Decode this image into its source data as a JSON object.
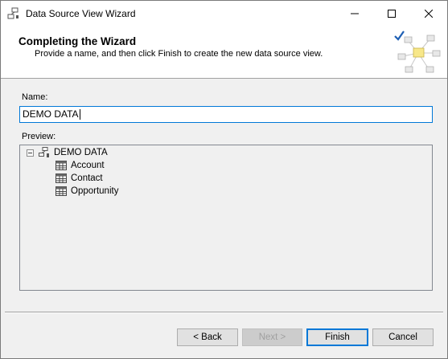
{
  "window": {
    "title": "Data Source View Wizard"
  },
  "banner": {
    "title": "Completing the Wizard",
    "subtitle": "Provide a name, and then click Finish to create the new data source view."
  },
  "form": {
    "name_label": "Name:",
    "name_value": "DEMO DATA",
    "preview_label": "Preview:"
  },
  "tree": {
    "root": "DEMO DATA",
    "tables": [
      "Account",
      "Contact",
      "Opportunity"
    ]
  },
  "buttons": {
    "back": "< Back",
    "next": "Next >",
    "finish": "Finish",
    "cancel": "Cancel"
  },
  "colors": {
    "accent": "#0078d7",
    "checkmark": "#1e5fb4",
    "node_yellow": "#f7e78a"
  }
}
